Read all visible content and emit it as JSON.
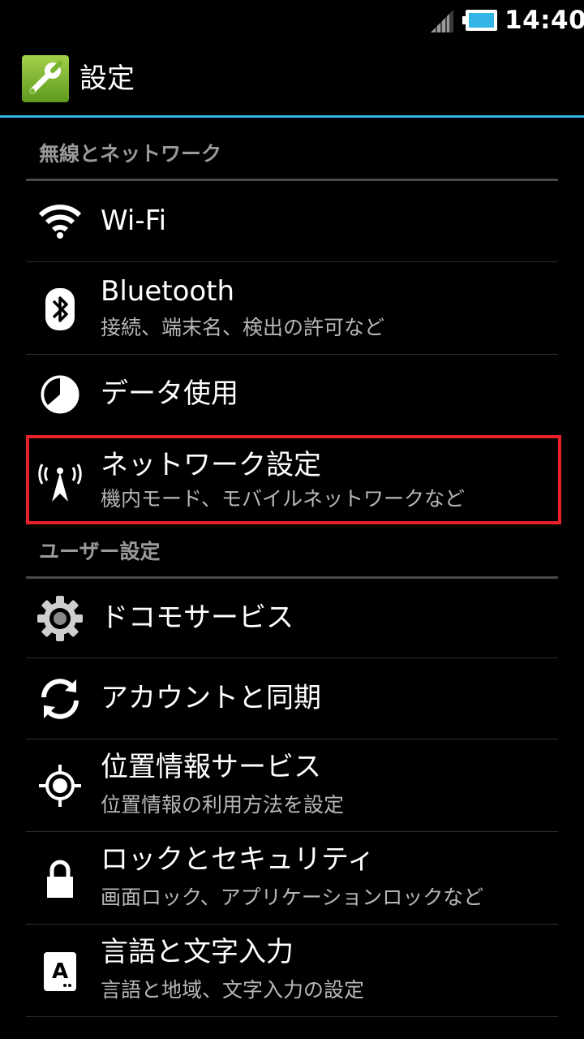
{
  "status_bar": {
    "time": "14:40",
    "signal_icon": "signal-icon",
    "battery_icon": "battery-icon"
  },
  "action_bar": {
    "app_icon": "wrench-icon",
    "title": "設定",
    "accent_color": "#33b5e5"
  },
  "sections": [
    {
      "header": "無線とネットワーク",
      "items": [
        {
          "icon": "wifi-icon",
          "title": "Wi-Fi",
          "summary": ""
        },
        {
          "icon": "bluetooth-icon",
          "title": "Bluetooth",
          "summary": "接続、端末名、検出の許可など"
        },
        {
          "icon": "data-usage-icon",
          "title": "データ使用",
          "summary": ""
        },
        {
          "icon": "antenna-icon",
          "title": "ネットワーク設定",
          "summary": "機内モード、モバイルネットワークなど",
          "highlighted": true
        }
      ]
    },
    {
      "header": "ユーザー設定",
      "items": [
        {
          "icon": "gear-icon",
          "title": "ドコモサービス",
          "summary": ""
        },
        {
          "icon": "sync-icon",
          "title": "アカウントと同期",
          "summary": ""
        },
        {
          "icon": "location-icon",
          "title": "位置情報サービス",
          "summary": "位置情報の利用方法を設定"
        },
        {
          "icon": "lock-icon",
          "title": "ロックとセキュリティ",
          "summary": "画面ロック、アプリケーションロックなど"
        },
        {
          "icon": "language-icon",
          "title": "言語と文字入力",
          "summary": "言語と地域、文字入力の設定"
        }
      ]
    }
  ],
  "highlight_color": "#e8202a"
}
